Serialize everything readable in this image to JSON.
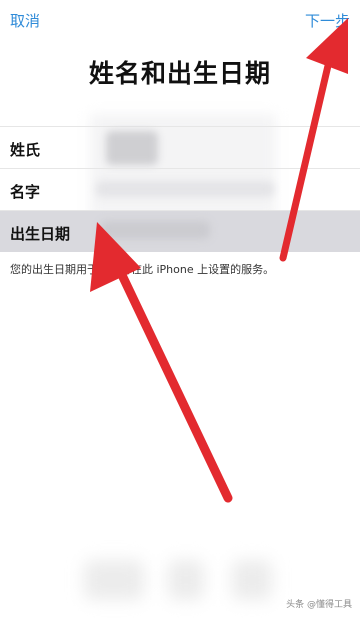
{
  "nav": {
    "cancel_label": "取消",
    "next_label": "下一步"
  },
  "title": "姓名和出生日期",
  "fields": [
    {
      "label": "姓氏"
    },
    {
      "label": "名字"
    },
    {
      "label": "出生日期"
    }
  ],
  "description": "您的出生日期用于确定可在此 iPhone 上设置的服务。",
  "watermark": "头条 @懂得工具",
  "annotation": {
    "arrow_color": "#e32a2f"
  },
  "colors": {
    "accent": "#2f8bd8",
    "highlight_row": "#d9d9de"
  }
}
